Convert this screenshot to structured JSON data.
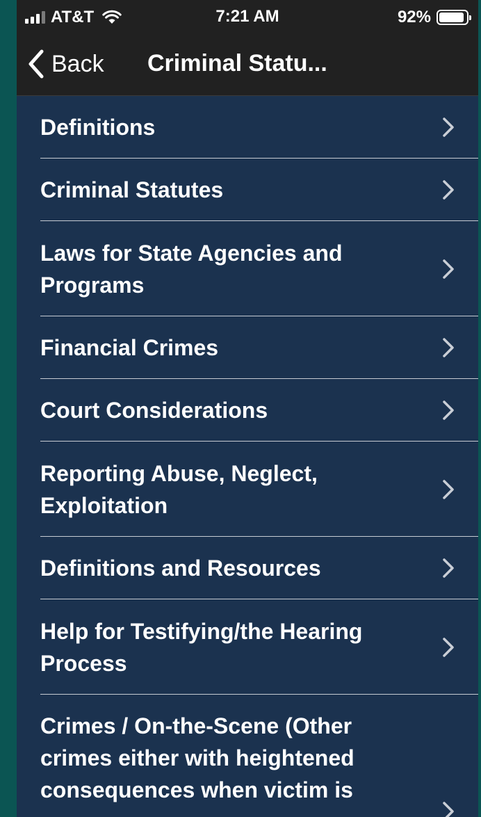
{
  "status_bar": {
    "carrier": "AT&T",
    "time": "7:21 AM",
    "battery_percent": "92%",
    "battery_level": 0.92,
    "signal_bars_active": 3,
    "signal_bars_total": 4
  },
  "nav": {
    "back_label": "Back",
    "title": "Criminal Statu..."
  },
  "colors": {
    "background_outer": "#0b5553",
    "bar_background": "#212121",
    "list_background": "#1b324f",
    "separator": "#c7ccd3",
    "text": "#ffffff"
  },
  "menu": {
    "items": [
      {
        "label": "Definitions"
      },
      {
        "label": "Criminal Statutes"
      },
      {
        "label": "Laws for State Agencies and Programs"
      },
      {
        "label": "Financial Crimes"
      },
      {
        "label": "Court Considerations"
      },
      {
        "label": "Reporting Abuse, Neglect, Exploitation"
      },
      {
        "label": "Definitions and Resources"
      },
      {
        "label": "Help for Testifying/the Hearing Process"
      },
      {
        "label": "Crimes / On-the-Scene (Other crimes either with heightened consequences when victim is"
      }
    ]
  }
}
